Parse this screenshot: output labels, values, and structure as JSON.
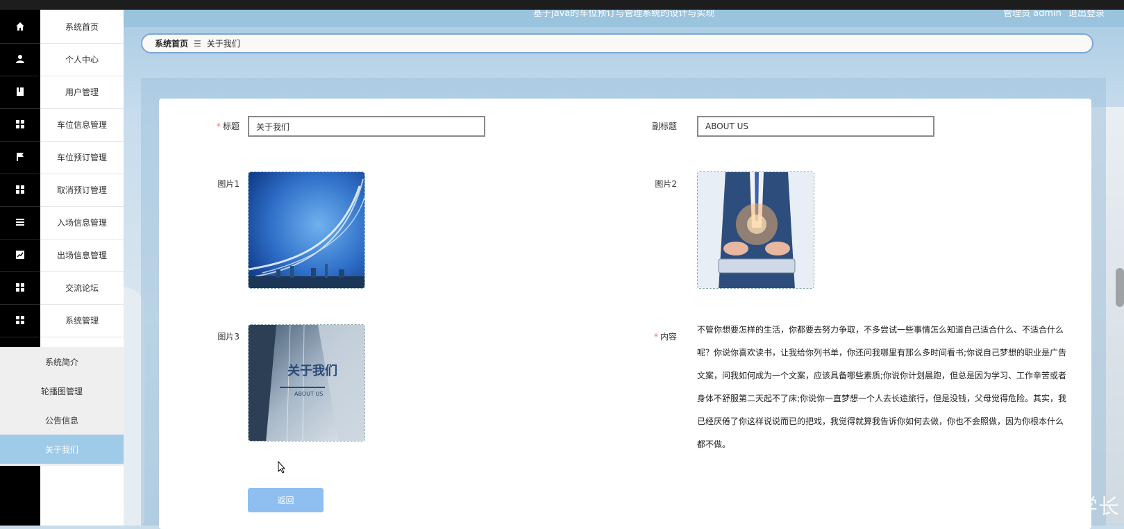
{
  "header": {
    "title": "基于java的车位预订与管理系统的设计与实现",
    "user": "管理员 admin",
    "logout": "退出登录"
  },
  "sidebar": {
    "items": [
      {
        "label": "系统首页",
        "icon": "home-icon"
      },
      {
        "label": "个人中心",
        "icon": "user-icon"
      },
      {
        "label": "用户管理",
        "icon": "book-icon"
      },
      {
        "label": "车位信息管理",
        "icon": "grid-icon"
      },
      {
        "label": "车位预订管理",
        "icon": "flag-icon"
      },
      {
        "label": "取消预订管理",
        "icon": "grid-icon"
      },
      {
        "label": "入场信息管理",
        "icon": "list-icon"
      },
      {
        "label": "出场信息管理",
        "icon": "chart-icon"
      },
      {
        "label": "交流论坛",
        "icon": "grid-icon"
      },
      {
        "label": "系统管理",
        "icon": "grid-icon"
      }
    ],
    "submenu": [
      {
        "label": "系统简介"
      },
      {
        "label": "轮播图管理"
      },
      {
        "label": "公告信息"
      },
      {
        "label": "关于我们"
      }
    ]
  },
  "breadcrumb": {
    "home": "系统首页",
    "separator": "☰",
    "current": "关于我们"
  },
  "form": {
    "title_label": "标题",
    "title_value": "关于我们",
    "subtitle_label": "副标题",
    "subtitle_value": "ABOUT US",
    "image1_label": "图片1",
    "image2_label": "图片2",
    "image3_label": "图片3",
    "image3_overlay": "关于我们",
    "image3_overlay_sub": "ABOUT US",
    "content_label": "内容",
    "content_value": "不管你想要怎样的生活，你都要去努力争取，不多尝试一些事情怎么知道自己适合什么、不适合什么呢？你说你喜欢读书，让我给你列书单，你还问我哪里有那么多时间看书;你说自己梦想的职业是广告文案，问我如何成为一个文案，应该具备哪些素质;你说你计划晨跑，但总是因为学习、工作辛苦或者身体不舒服第二天起不了床;你说你一直梦想一个人去长途旅行，但是没钱，父母觉得危险。其实，我已经厌倦了你这样说说而已的把戏，我觉得就算我告诉你如何去做，你也不会照做，因为你根本什么都不做。",
    "back_button": "返回"
  },
  "watermark": "CSDN @小光学长",
  "colors": {
    "accent": "#9fcbe8",
    "button": "#8fbff0",
    "required": "#f56c6c"
  }
}
